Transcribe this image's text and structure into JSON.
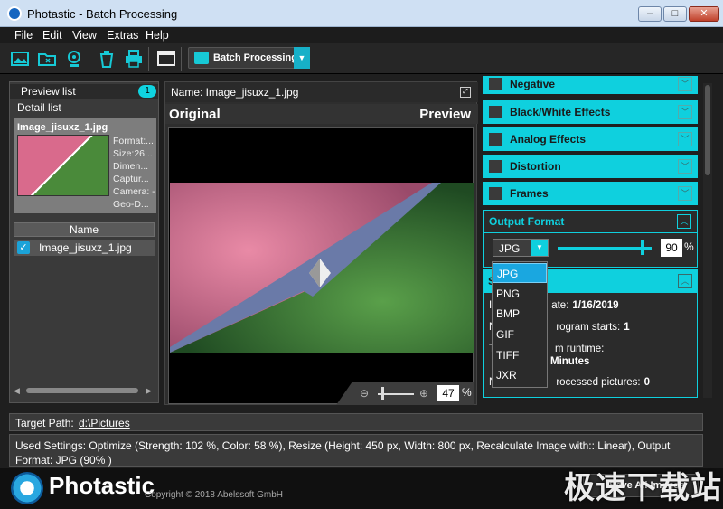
{
  "window": {
    "title": "Photastic - Batch Processing",
    "min": "‒",
    "max": "□",
    "close": "✕"
  },
  "menu": [
    "File",
    "Edit",
    "View",
    "Extras",
    "Help"
  ],
  "toolbar": {
    "batch_label": "Batch Processing",
    "batch_dd": "▼"
  },
  "left_panel": {
    "tab_preview": "Preview list",
    "tab_preview_count": "1",
    "tab_detail": "Detail list",
    "thumb_name": "Image_jisuxz_1.jpg",
    "meta": [
      "Format:...",
      "Size:26...",
      "Dimen...",
      "Captur...",
      "Camera: -",
      "Geo-D..."
    ],
    "column_name": "Name",
    "row_name": "Image_jisuxz_1.jpg",
    "row_check": "✓",
    "scroll_left": "◀",
    "scroll_right": "▶"
  },
  "center": {
    "name_label": "Name: Image_jisuxz_1.jpg",
    "original": "Original",
    "preview": "Preview",
    "expand": "⤢",
    "zoom_value": "47",
    "zoom_pct": "%",
    "zoom_out_icon": "⊖",
    "zoom_in_icon": "⊕"
  },
  "right": {
    "sections": [
      "Negative",
      "Black/White Effects",
      "Analog Effects",
      "Distortion",
      "Frames"
    ],
    "chev": "﹀",
    "chev_up": "︿",
    "output_format_label": "Output Format",
    "format_value": "JPG",
    "format_dd": "▼",
    "quality_level": 0.9,
    "quality_value": "90",
    "quality_pct": "%",
    "stats_label": "S",
    "stats_lines": [
      {
        "label": "I",
        "label2": "ate:",
        "value": "1/16/2019"
      },
      {
        "label": "N",
        "label2": "rogram starts:",
        "value": "1"
      },
      {
        "label": "T",
        "label2": "m runtime:",
        "value": ""
      },
      {
        "label": "",
        "label2": "",
        "value": "Minutes"
      },
      {
        "label": "N",
        "label2": "rocessed pictures:",
        "value": "0"
      }
    ]
  },
  "dropdown": {
    "options": [
      "JPG",
      "PNG",
      "BMP",
      "GIF",
      "TIFF",
      "JXR"
    ],
    "selected": "JPG"
  },
  "bottom": {
    "target_label": "Target Path:",
    "target_path": "d:\\Pictures",
    "settings": "Used Settings: Optimize (Strength: 102 %, Color: 58 %), Resize (Height: 450 px, Width: 800 px, Recalculate Image with:: Linear), Output Format: JPG (90% )",
    "brand": "Photastic",
    "copyright": "Copyright © 2018 Abelssoft GmbH",
    "save_all": "Save All Images"
  },
  "watermark": "极速下载站",
  "colors": {
    "accent": "#0fd0de",
    "selected": "#1aa7e0",
    "background": "#1f1f1f"
  }
}
